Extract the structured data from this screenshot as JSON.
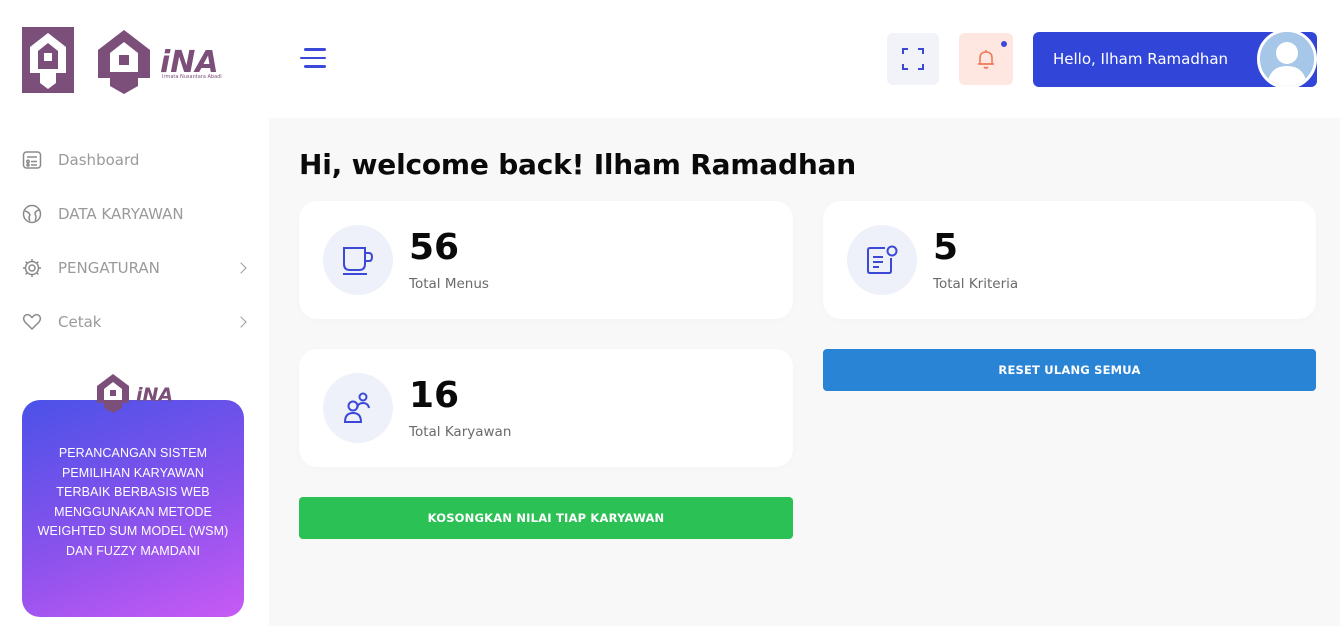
{
  "brand": {
    "logo_text": "iNA",
    "logo_caption": "Irmata Nusantara Abadi"
  },
  "sidebar": {
    "items": [
      {
        "label": "Dashboard",
        "icon": "dashboard-icon",
        "has_submenu": false
      },
      {
        "label": "DATA KARYAWAN",
        "icon": "globe-icon",
        "has_submenu": false
      },
      {
        "label": "PENGATURAN",
        "icon": "gear-icon",
        "has_submenu": true
      },
      {
        "label": "Cetak",
        "icon": "heart-icon",
        "has_submenu": true
      }
    ],
    "promo": {
      "logo_text": "iNA",
      "text": "PERANCANGAN SISTEM PEMILIHAN KARYAWAN TERBAIK BERBASIS WEB MENGGUNAKAN METODE WEIGHTED SUM MODEL (WSM) DAN FUZZY MAMDANI"
    }
  },
  "header": {
    "greeting": "Hello, Ilham Ramadhan",
    "icons": [
      "menu-icon",
      "fullscreen-icon",
      "bell-icon",
      "user-avatar"
    ]
  },
  "main": {
    "welcome": "Hi, welcome back! Ilham Ramadhan",
    "cards": [
      {
        "value": "56",
        "label": "Total Menus",
        "icon": "cup-icon"
      },
      {
        "value": "5",
        "label": "Total Kriteria",
        "icon": "document-icon"
      },
      {
        "value": "16",
        "label": "Total Karyawan",
        "icon": "users-icon"
      }
    ],
    "buttons": {
      "reset": "RESET ULANG SEMUA",
      "clear": "KOSONGKAN NILAI TIAP KARYAWAN"
    }
  },
  "colors": {
    "accent": "#3146d9",
    "brand": "#7b4f79",
    "reset_button": "#2a84d6",
    "clear_button": "#2bc155"
  }
}
